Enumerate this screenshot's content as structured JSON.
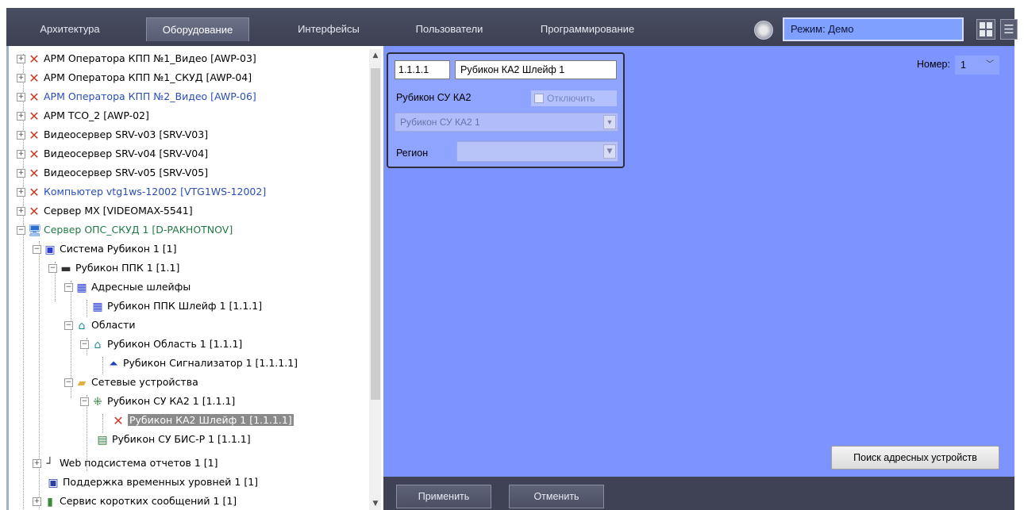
{
  "menu": {
    "tabs": [
      {
        "label": "Архитектура"
      },
      {
        "label": "Оборудование"
      },
      {
        "label": "Интерфейсы"
      },
      {
        "label": "Пользователи"
      },
      {
        "label": "Программирование"
      }
    ],
    "active_tab": "Оборудование",
    "mode": "Режим: Демо",
    "list_glyph": "☰"
  },
  "tree": {
    "items": [
      {
        "label": "АРМ Оператора КПП №1_Видео [AWP-03]",
        "icon": "x-icon"
      },
      {
        "label": "АРМ Оператора КПП №1_СКУД [AWP-04]",
        "icon": "x-icon"
      },
      {
        "label": "АРМ Оператора КПП №2_Видео [AWP-06]",
        "icon": "x-icon"
      },
      {
        "label": "АРМ ТСО_2 [AWP-02]",
        "icon": "x-icon"
      },
      {
        "label": "Видеосервер SRV-v03 [SRV-V03]",
        "icon": "x-icon"
      },
      {
        "label": "Видеосервер SRV-v04 [SRV-V04]",
        "icon": "x-icon"
      },
      {
        "label": "Видеосервер SRV-v05 [SRV-V05]",
        "icon": "x-icon"
      },
      {
        "label": "Компьютер vtg1ws-12002 [VTG1WS-12002]",
        "icon": "x-icon"
      },
      {
        "label": "Сервер MX [VIDEOMAX-5541]",
        "icon": "x-icon"
      },
      {
        "label": "Сервер ОПС_СКУД 1 [D-PAKHOTNOV]",
        "icon": "computer-icon"
      },
      {
        "label": "Система Рубикон 1 [1]",
        "icon": "system-icon"
      },
      {
        "label": "Рубикон ППК 1 [1.1]",
        "icon": "panel-icon"
      },
      {
        "label": "Адресные шлейфы",
        "icon": "loops-icon"
      },
      {
        "label": "Рубикон ППК Шлейф 1 [1.1.1]",
        "icon": "loop-icon"
      },
      {
        "label": "Области",
        "icon": "areas-icon"
      },
      {
        "label": "Рубикон Область 1 [1.1.1]",
        "icon": "area-icon"
      },
      {
        "label": "Рубикон Сигнализатор 1 [1.1.1.1]",
        "icon": "siren-icon"
      },
      {
        "label": "Сетевые устройства",
        "icon": "folder-icon"
      },
      {
        "label": "Рубикон СУ КА2 1 [1.1.1]",
        "icon": "network-device-icon"
      },
      {
        "label": "Рубикон КА2 Шлейф 1 [1.1.1.1]",
        "icon": "x-icon"
      },
      {
        "label": "Рубикон СУ БИС-Р 1 [1.1.1]",
        "icon": "bis-icon"
      },
      {
        "label": "Web подсистема отчетов 1 [1]",
        "icon": "web-icon"
      },
      {
        "label": "Поддержка временных уровней 1 [1]",
        "icon": "time-icon"
      },
      {
        "label": "Сервис коротких сообщений 1 [1]",
        "icon": "sms-icon"
      }
    ]
  },
  "settings": {
    "id_value": "1.1.1.1",
    "name_value": "Рубикон КА2 Шлейф 1",
    "parent_label": "Рубикон СУ КА2",
    "disable_label": "Отключить",
    "parent_select_value": "Рубикон СУ КА2 1",
    "region_label": "Регион",
    "region_value": "",
    "number_label": "Номер:",
    "number_value": "1",
    "search_button": "Поиск адресных устройств"
  },
  "footer": {
    "apply_label": "Применить",
    "cancel_label": "Отменить"
  },
  "colors": {
    "menu_bar": "#3d4052",
    "settings_bg": "#7d93ff",
    "mode_box": "#7fa0ff",
    "error_x": "#d03a2a",
    "link_blue": "#2a4db8",
    "server_green": "#1f7a44"
  }
}
